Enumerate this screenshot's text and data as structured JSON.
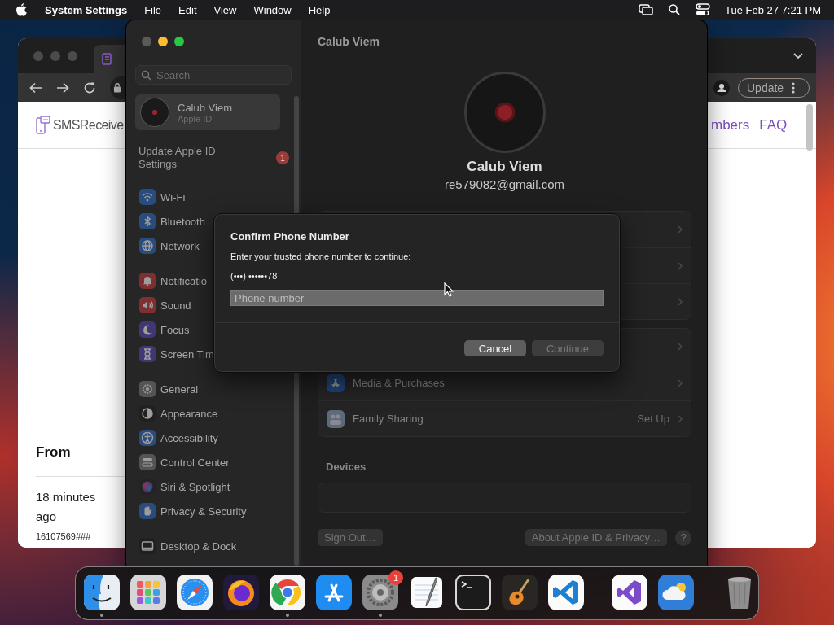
{
  "menu_bar": {
    "app": "System Settings",
    "menus": [
      "File",
      "Edit",
      "View",
      "Window",
      "Help"
    ],
    "clock": "Tue Feb 27  7:21 PM"
  },
  "browser": {
    "logo": "SMSReceive",
    "nav_links": [
      "mbers",
      "FAQ"
    ],
    "update_button": "Update",
    "from_heading": "From",
    "message_time": "18 minutes ago",
    "message_sender": "16107569###"
  },
  "settings": {
    "search": {
      "placeholder": "Search"
    },
    "account": {
      "name": "Calub Viem",
      "subtitle": "Apple ID",
      "selected": true
    },
    "update_notice": {
      "label": "Update Apple ID Settings",
      "badge": "1"
    },
    "sidebar_groups": [
      [
        {
          "label": "Wi-Fi",
          "selected": false
        },
        {
          "label": "Bluetooth",
          "selected": false
        },
        {
          "label": "Network",
          "selected": false
        }
      ],
      [
        {
          "label": "Notificatio",
          "selected": false
        },
        {
          "label": "Sound",
          "selected": false
        },
        {
          "label": "Focus",
          "selected": false
        },
        {
          "label": "Screen Tim",
          "selected": false
        }
      ],
      [
        {
          "label": "General",
          "selected": false
        },
        {
          "label": "Appearance",
          "selected": false
        },
        {
          "label": "Accessibility",
          "selected": false
        },
        {
          "label": "Control Center",
          "selected": false
        },
        {
          "label": "Siri & Spotlight",
          "selected": false
        },
        {
          "label": "Privacy & Security",
          "selected": false
        }
      ],
      [
        {
          "label": "Desktop & Dock",
          "selected": false
        }
      ]
    ],
    "header_title": "Calub Viem",
    "profile": {
      "name": "Calub Viem",
      "email": "re579082@gmail.com"
    },
    "rows": [
      {
        "label": "Media & Purchases"
      },
      {
        "label": "Family Sharing",
        "value": "Set Up"
      }
    ],
    "devices_heading": "Devices",
    "sign_out_button": "Sign Out…",
    "about_button": "About Apple ID & Privacy…",
    "help_button": "?"
  },
  "dialog": {
    "title": "Confirm Phone Number",
    "message": "Enter your trusted phone number to continue:",
    "masked_number": "(•••) ••••••78",
    "input": {
      "placeholder": "Phone number"
    },
    "buttons": [
      {
        "label": "Cancel",
        "disabled": false
      },
      {
        "label": "Continue",
        "disabled": true
      }
    ]
  },
  "dock": {
    "apps": [
      {
        "running": true
      },
      {
        "running": false
      },
      {
        "running": false
      },
      {
        "running": false
      },
      {
        "running": true
      },
      {
        "running": false
      },
      {
        "running": true,
        "badge": "1"
      },
      {
        "running": false
      },
      {
        "running": false
      },
      {
        "running": false
      },
      {
        "running": false
      },
      {
        "running": false
      },
      {
        "running": false
      },
      {
        "running": false
      }
    ]
  }
}
